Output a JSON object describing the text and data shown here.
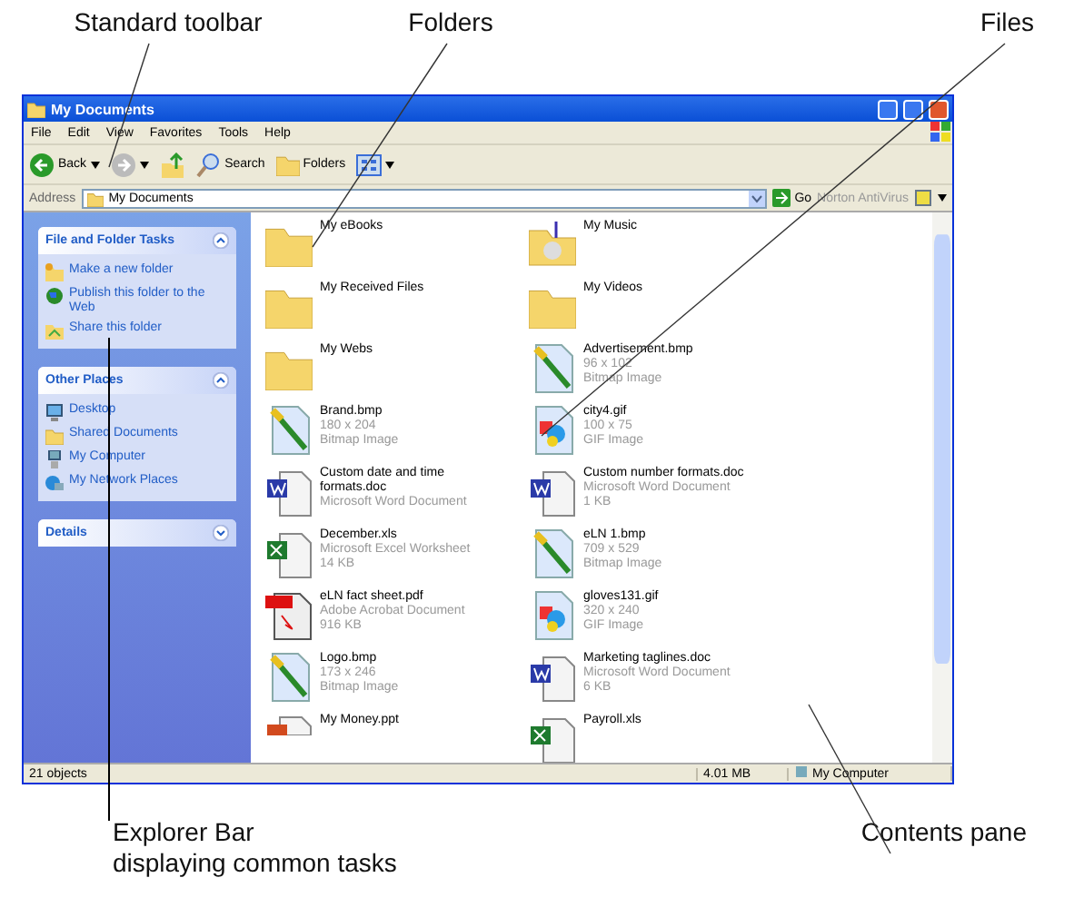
{
  "callouts_top": [
    {
      "text": "Standard toolbar"
    },
    {
      "text": "Folders"
    },
    {
      "text": "Files"
    }
  ],
  "window": {
    "title": "My Documents"
  },
  "menu": [
    "File",
    "Edit",
    "View",
    "Favorites",
    "Tools",
    "Help"
  ],
  "toolbar": [
    {
      "kind": "back",
      "label": "Back"
    },
    {
      "kind": "forward"
    },
    {
      "kind": "up"
    },
    {
      "kind": "search",
      "label": "Search"
    },
    {
      "kind": "folders",
      "label": "Folders"
    },
    {
      "kind": "views"
    }
  ],
  "address": {
    "label": "Address",
    "value": "My Documents",
    "go": "Go",
    "extra": "Norton AntiVirus"
  },
  "sidebar": [
    {
      "title": "File and Folder Tasks",
      "expanded": true,
      "items": [
        {
          "kind": "newfolder",
          "label": "Make a new folder"
        },
        {
          "kind": "globe",
          "label": "Publish this folder to the Web"
        },
        {
          "kind": "share",
          "label": "Share this folder"
        }
      ]
    },
    {
      "title": "Other Places",
      "expanded": true,
      "items": [
        {
          "kind": "desktop",
          "label": "Desktop"
        },
        {
          "kind": "folder",
          "label": "Shared Documents"
        },
        {
          "kind": "computer",
          "label": "My Computer"
        },
        {
          "kind": "network",
          "label": "My Network Places"
        }
      ]
    },
    {
      "title": "Details",
      "expanded": false
    }
  ],
  "files": [
    {
      "kind": "folder",
      "name": "My eBooks"
    },
    {
      "kind": "music",
      "name": "My Music"
    },
    {
      "kind": "folder",
      "name": "My Received Files"
    },
    {
      "kind": "folder",
      "name": "My Videos"
    },
    {
      "kind": "folder",
      "name": "My Webs"
    },
    {
      "kind": "bmp",
      "name": "Advertisement.bmp",
      "details": [
        "96 x 102",
        "Bitmap Image"
      ]
    },
    {
      "kind": "bmp",
      "name": "Brand.bmp",
      "details": [
        "180 x 204",
        "Bitmap Image"
      ]
    },
    {
      "kind": "gif",
      "name": "city4.gif",
      "details": [
        "100 x 75",
        "GIF Image"
      ]
    },
    {
      "kind": "doc",
      "name": "Custom date and time formats.doc",
      "details": [
        "Microsoft Word Document"
      ]
    },
    {
      "kind": "doc",
      "name": "Custom number formats.doc",
      "details": [
        "Microsoft Word Document",
        "1 KB"
      ]
    },
    {
      "kind": "xls",
      "name": "December.xls",
      "details": [
        "Microsoft Excel Worksheet",
        "14 KB"
      ]
    },
    {
      "kind": "bmp",
      "name": "eLN 1.bmp",
      "details": [
        "709 x 529",
        "Bitmap Image"
      ]
    },
    {
      "kind": "pdf",
      "name": "eLN fact sheet.pdf",
      "details": [
        "Adobe Acrobat Document",
        "916 KB"
      ]
    },
    {
      "kind": "gif",
      "name": "gloves131.gif",
      "details": [
        "320 x 240",
        "GIF Image"
      ]
    },
    {
      "kind": "bmp",
      "name": "Logo.bmp",
      "details": [
        "173 x 246",
        "Bitmap Image"
      ]
    },
    {
      "kind": "doc",
      "name": "Marketing taglines.doc",
      "details": [
        "Microsoft Word Document",
        "6 KB"
      ]
    },
    {
      "kind": "ppt",
      "name": "My Money.ppt"
    },
    {
      "kind": "xls",
      "name": "Payroll.xls"
    }
  ],
  "status_bar": {
    "count": "21 objects",
    "size": "4.01 MB",
    "zone": "My Computer"
  },
  "callouts_bottom": [
    {
      "lines": [
        "Explorer Bar",
        "displaying common tasks"
      ]
    },
    {
      "lines": [
        "Contents pane"
      ]
    }
  ]
}
